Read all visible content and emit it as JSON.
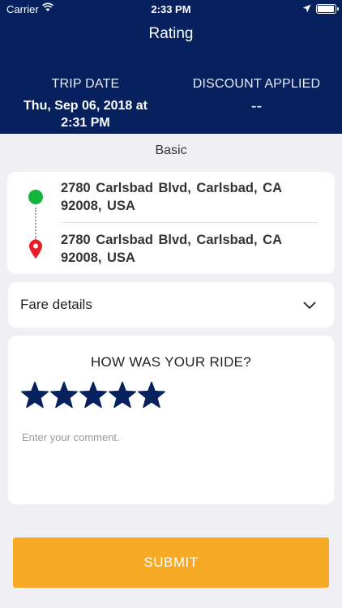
{
  "status_bar": {
    "carrier": "Carrier",
    "time": "2:33 PM",
    "wifi_icon": "wifi-icon",
    "location_icon": "location-arrow-icon",
    "battery_icon": "battery-icon",
    "battery_level": 1.0
  },
  "header": {
    "title": "Rating",
    "background_color": "#06215e",
    "trip_date_label": "TRIP DATE",
    "trip_date_line1": "Thu, Sep 06, 2018 at",
    "trip_date_line2": "2:31 PM",
    "discount_label": "DISCOUNT APPLIED",
    "discount_value": "--"
  },
  "plan_name": "Basic",
  "route": {
    "pickup_line1": "2780 Carlsbad Blvd,  Carlsbad,  CA",
    "pickup_line2": "92008,  USA",
    "dropoff_line1": "2780 Carlsbad Blvd,  Carlsbad,  CA",
    "dropoff_line2": "92008,  USA",
    "pickup_color": "#16b33a",
    "dropoff_color": "#e81d25"
  },
  "fare": {
    "label": "Fare details",
    "icon": "chevron-down-icon"
  },
  "rating": {
    "title": "HOW WAS YOUR RIDE?",
    "stars_filled": 5,
    "stars_total": 5,
    "star_color": "#06215e",
    "comment_placeholder": "Enter your comment."
  },
  "submit": {
    "label": "SUBMIT",
    "color": "#f6a924"
  }
}
